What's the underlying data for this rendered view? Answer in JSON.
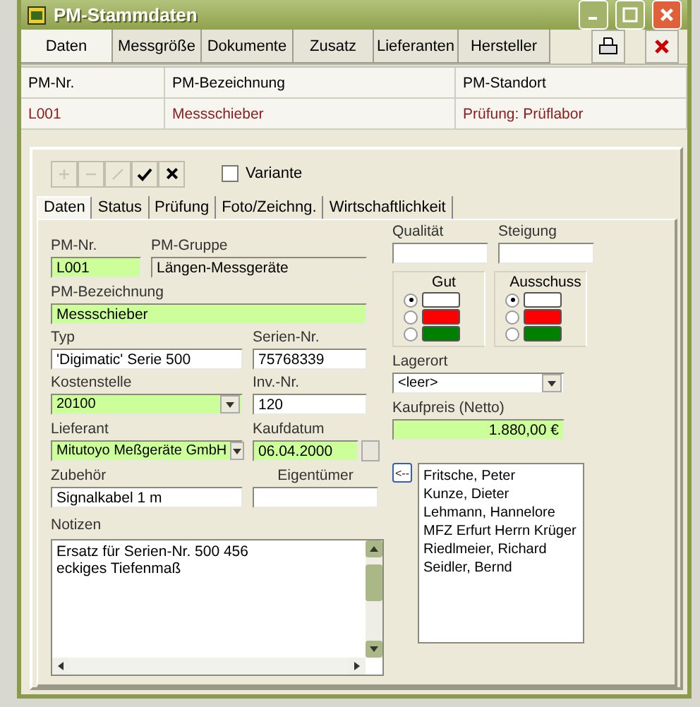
{
  "window": {
    "title": "PM-Stammdaten"
  },
  "top_tabs": [
    {
      "label": "Daten",
      "selected": true
    },
    {
      "label": "Messgröße",
      "selected": false
    },
    {
      "label": "Dokumente",
      "selected": false
    },
    {
      "label": "Zusatz",
      "selected": false
    },
    {
      "label": "Lieferanten",
      "selected": false
    },
    {
      "label": "Hersteller",
      "selected": false
    }
  ],
  "table": {
    "columns": [
      "PM-Nr.",
      "PM-Bezeichnung",
      "PM-Standort"
    ],
    "rows": [
      [
        "L001",
        "Messschieber",
        "Prüfung: Prüflabor"
      ]
    ]
  },
  "edit_toolbar": [
    {
      "kind": "add",
      "disabled": true
    },
    {
      "kind": "remove",
      "disabled": true
    },
    {
      "kind": "edit",
      "disabled": true
    },
    {
      "kind": "save",
      "disabled": false
    },
    {
      "kind": "cancel",
      "disabled": false
    }
  ],
  "variante": {
    "label": "Variante",
    "checked": false
  },
  "sub_tabs": [
    {
      "label": "Daten",
      "selected": true
    },
    {
      "label": "Status",
      "selected": false
    },
    {
      "label": "Prüfung",
      "selected": false
    },
    {
      "label": "Foto/Zeichng.",
      "selected": false
    },
    {
      "label": "Wirtschaftlichkeit",
      "selected": false
    }
  ],
  "pm_nr": {
    "label": "PM-Nr.",
    "value": "L001",
    "required": true
  },
  "pm_gruppe": {
    "label": "PM-Gruppe",
    "value": "Längen-Messgeräte",
    "required": false
  },
  "pm_bezeichnung": {
    "label": "PM-Bezeichnung",
    "value": "Messschieber",
    "required": true
  },
  "typ": {
    "label": "Typ",
    "value": "'Digimatic' Serie 500",
    "required": false
  },
  "serien_nr": {
    "label": "Serien-Nr.",
    "value": "75768339",
    "required": false
  },
  "kostenstelle": {
    "label": "Kostenstelle",
    "value": "20100",
    "required": true
  },
  "inv_nr": {
    "label": "Inv.-Nr.",
    "value": "120",
    "required": false
  },
  "lieferant": {
    "label": "Lieferant",
    "value": "Mitutoyo Meßgeräte GmbH",
    "required": true
  },
  "kaufdatum": {
    "label": "Kaufdatum",
    "value": "06.04.2000",
    "required": true
  },
  "zubehoer": {
    "label": "Zubehör",
    "value": "Signalkabel 1 m",
    "required": false
  },
  "eigentuemer": {
    "label": "Eigentümer",
    "required": false
  },
  "notizen": {
    "label": "Notizen",
    "value": "Ersatz für Serien-Nr. 500 456\neckiges Tiefenmaß"
  },
  "qualitaet": {
    "label": "Qualität",
    "required": false
  },
  "steigung": {
    "label": "Steigung",
    "required": false
  },
  "color_groups": [
    {
      "label": "Gut",
      "options": [
        {
          "color": "#ffffff",
          "selected": true
        },
        {
          "color": "#ff0000",
          "selected": false
        },
        {
          "color": "#008000",
          "selected": false
        }
      ]
    },
    {
      "label": "Ausschuss",
      "options": [
        {
          "color": "#ffffff",
          "selected": true
        },
        {
          "color": "#ff0000",
          "selected": false
        },
        {
          "color": "#008000",
          "selected": false
        }
      ]
    }
  ],
  "lagerort": {
    "label": "Lagerort",
    "value": "<leer>",
    "required": false
  },
  "kaufpreis": {
    "label": "Kaufpreis (Netto)",
    "value": "1.880,00 €",
    "required": true
  },
  "move_button": {
    "label": "<--"
  },
  "owners": [
    "Fritsche, Peter",
    "Kunze, Dieter",
    "Lehmann, Hannelore",
    "MFZ Erfurt Herrn Krüger",
    "Riedlmeier, Richard",
    "Seidler, Bernd"
  ]
}
